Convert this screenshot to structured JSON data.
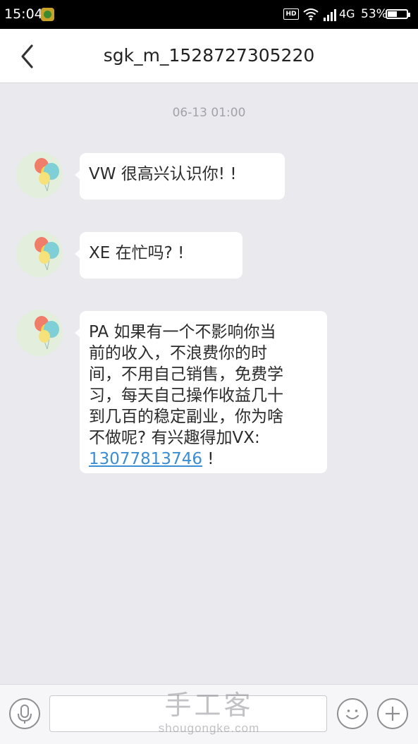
{
  "status_bar": {
    "time": "15:04",
    "hd": "HD",
    "network": "4G",
    "battery_percent": "53%",
    "battery_level": 0.53
  },
  "header": {
    "title": "sgk_m_1528727305220"
  },
  "conversation": {
    "timestamp": "06-13 01:00",
    "messages": [
      {
        "lines": [
          "VW  很高兴认识你!  !"
        ]
      },
      {
        "lines": [
          "XE  在忙吗?   !"
        ]
      },
      {
        "lines": [
          "PA  如果有一个不影响你当",
          "前的收入，不浪费你的时",
          "间，不用自己销售，免费学",
          "习，每天自己操作收益几十",
          "到几百的稳定副业，你为啥",
          "不做呢? 有兴趣得加VX:"
        ],
        "phone": "13077813746",
        "tail": "   !"
      }
    ]
  },
  "input_bar": {
    "placeholder": ""
  },
  "watermark": {
    "title": "手工客",
    "domain": "shougongke.com"
  },
  "colors": {
    "background": "#e9e9ee",
    "bubble": "#ffffff",
    "link": "#3a8ed1"
  },
  "icons": [
    "back-icon",
    "wifi-icon",
    "signal-icon",
    "battery-icon",
    "microphone-icon",
    "emoji-icon",
    "plus-icon",
    "balloon-avatar"
  ]
}
